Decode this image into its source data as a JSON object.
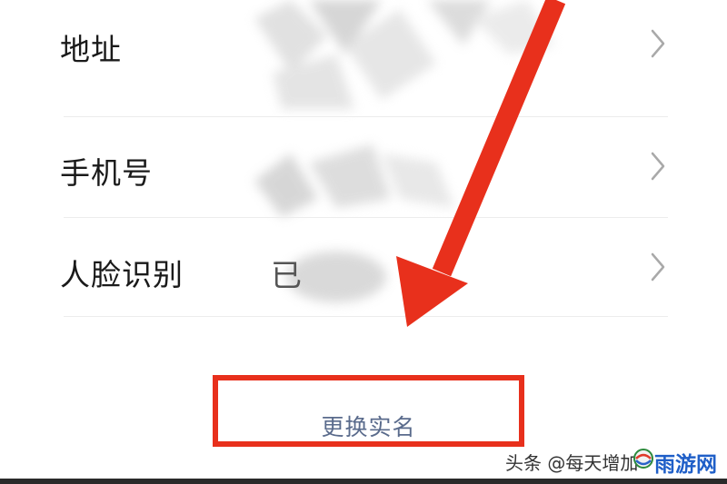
{
  "settings": {
    "rows": [
      {
        "label": "地址"
      },
      {
        "label": "手机号"
      },
      {
        "label": "人脸识别",
        "value_partial": "已"
      }
    ]
  },
  "change_button": {
    "label": "更换实名"
  },
  "watermark": {
    "text": "头条 @每天增加",
    "brand": "雨游网"
  },
  "colors": {
    "annotation_red": "#e8301c",
    "button_text": "#5a6b8c",
    "brand_blue": "#1f5fc8"
  },
  "icons": {
    "chevron": "chevron-right-icon",
    "arrow": "red-arrow-annotation",
    "logo": "brand-logo-icon"
  }
}
